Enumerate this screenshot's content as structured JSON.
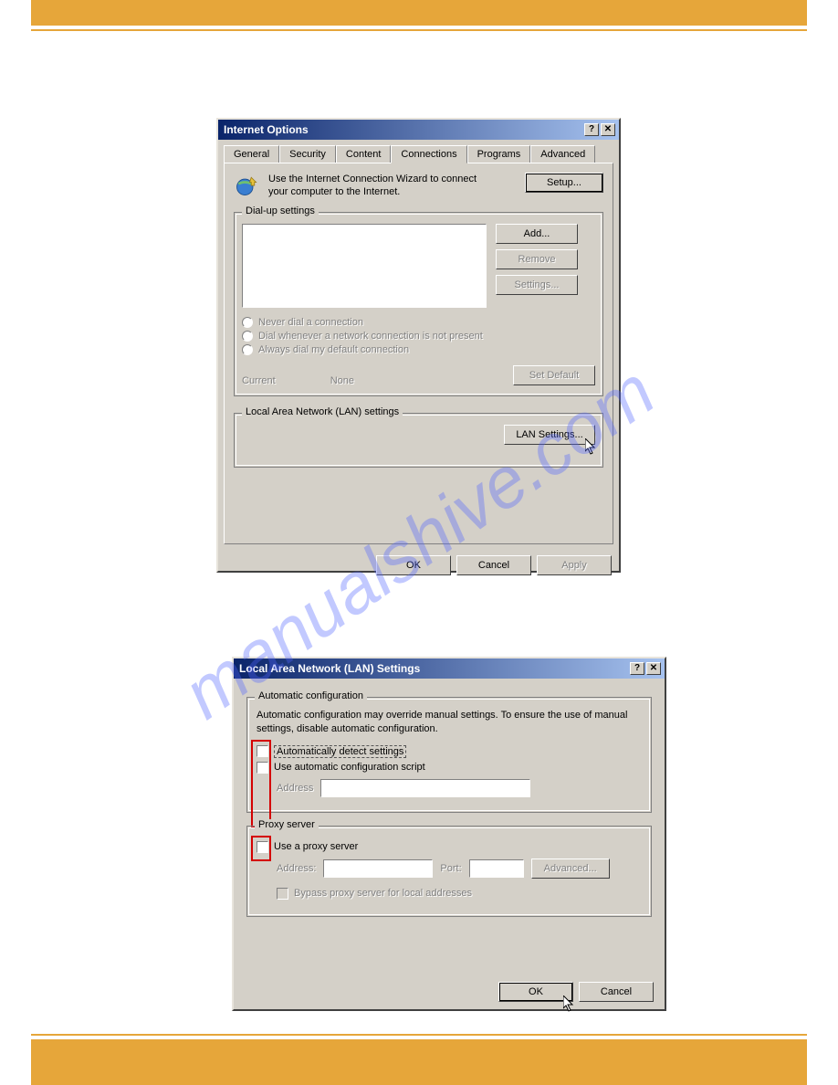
{
  "page": {
    "watermark": "manualshive.com"
  },
  "dialog1": {
    "title": "Internet Options",
    "tabs": {
      "general": "General",
      "security": "Security",
      "content": "Content",
      "connections": "Connections",
      "programs": "Programs",
      "advanced": "Advanced"
    },
    "intro": "Use the Internet Connection Wizard to connect your computer to the Internet.",
    "setup_btn": "Setup...",
    "dialup": {
      "legend": "Dial-up settings",
      "add_btn": "Add...",
      "remove_btn": "Remove",
      "settings_btn": "Settings...",
      "never": "Never dial a connection",
      "whenever": "Dial whenever a network connection is not present",
      "always": "Always dial my default connection",
      "current_label": "Current",
      "current_value": "None",
      "setdefault_btn": "Set Default"
    },
    "lan": {
      "legend": "Local Area Network (LAN) settings",
      "btn": "LAN Settings..."
    },
    "buttons": {
      "ok": "OK",
      "cancel": "Cancel",
      "apply": "Apply"
    }
  },
  "dialog2": {
    "title": "Local Area Network (LAN) Settings",
    "auto": {
      "legend": "Automatic configuration",
      "desc": "Automatic configuration may override manual settings.  To ensure the use of manual settings, disable automatic configuration.",
      "detect": "Automatically detect settings",
      "script": "Use automatic configuration script",
      "address_label": "Address"
    },
    "proxy": {
      "legend": "Proxy server",
      "use": "Use a proxy server",
      "address_label": "Address:",
      "port_label": "Port:",
      "advanced_btn": "Advanced...",
      "bypass": "Bypass proxy server for local addresses"
    },
    "buttons": {
      "ok": "OK",
      "cancel": "Cancel"
    }
  }
}
